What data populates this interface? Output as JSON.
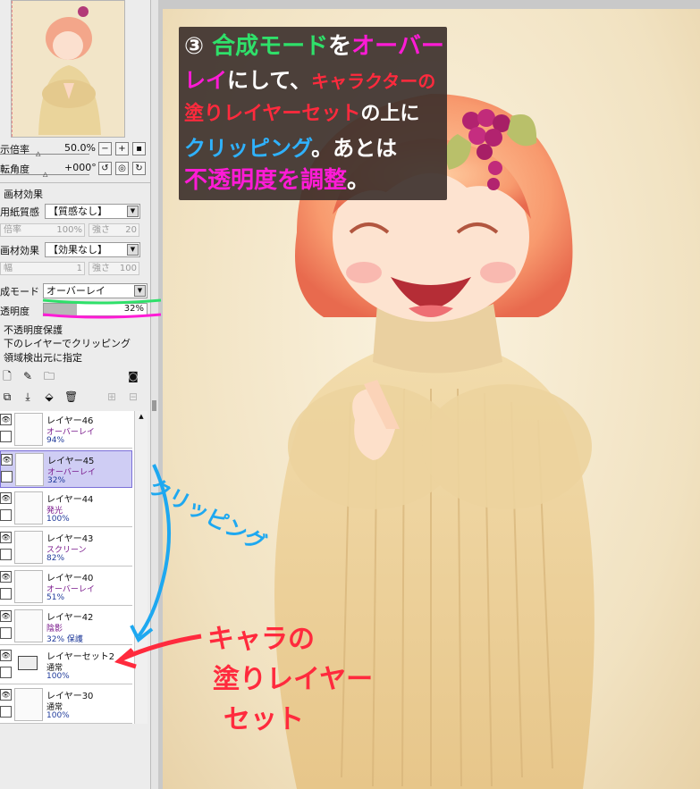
{
  "navigator": {
    "thumb_desc": ""
  },
  "view": {
    "zoom_label": "示倍率",
    "zoom_value": "50.0%",
    "rotate_label": "転角度",
    "rotate_value": "+000°"
  },
  "texture": {
    "header": "画材効果",
    "paper_label": "用紙質感",
    "paper_value": "【質感なし】",
    "paper_scale_label": "倍率",
    "paper_scale_value": "100%",
    "paper_strength_label": "強さ",
    "paper_strength_value": "20",
    "effect_label": "画材効果",
    "effect_value": "【効果なし】",
    "effect_width_label": "幅",
    "effect_width_value": "1",
    "effect_strength_label": "強さ",
    "effect_strength_value": "100"
  },
  "blend": {
    "mode_label": "成モード",
    "mode_value": "オーバーレイ",
    "opacity_label": "透明度",
    "opacity_value": "32%",
    "opacity_fraction": 0.32,
    "protect_opacity": "不透明度保護",
    "clip_below": "下のレイヤーでクリッピング",
    "selection_source": "領域検出元に指定"
  },
  "layers": [
    {
      "name": "レイヤー46",
      "mode": "オーバーレイ",
      "opacity": "94%",
      "selected": false,
      "mode_color": "#7a1a8c"
    },
    {
      "name": "レイヤー45",
      "mode": "オーバーレイ",
      "opacity": "32%",
      "selected": true,
      "mode_color": "#7a1a8c"
    },
    {
      "name": "レイヤー44",
      "mode": "発光",
      "opacity": "100%",
      "selected": false,
      "mode_color": "#7a1a8c"
    },
    {
      "name": "レイヤー43",
      "mode": "スクリーン",
      "opacity": "82%",
      "selected": false,
      "mode_color": "#7a1a8c"
    },
    {
      "name": "レイヤー40",
      "mode": "オーバーレイ",
      "opacity": "51%",
      "selected": false,
      "mode_color": "#7a1a8c"
    },
    {
      "name": "レイヤー42",
      "mode": "陰影",
      "opacity": "32% 保護",
      "selected": false,
      "mode_color": "#7a1a8c"
    },
    {
      "name": "レイヤーセット2",
      "mode": "通常",
      "opacity": "100%",
      "selected": false,
      "mode_color": "#111"
    },
    {
      "name": "レイヤー30",
      "mode": "通常",
      "opacity": "100%",
      "selected": false,
      "mode_color": "#111"
    }
  ],
  "instruction": {
    "num": "③",
    "line1a": "合成モード",
    "line1b": "を",
    "line1c": "オーバー",
    "line2a": "レイ",
    "line2b": "にして、",
    "line2c": "キャラクターの",
    "line3a": "塗りレイヤーセット",
    "line3b": "の上に",
    "line4a": "クリッピング",
    "line4b": "。あとは",
    "line5a": "不透明度を調整",
    "line5b": "。"
  },
  "annotations": {
    "clipping": "クリッピング",
    "chara_line1": "キャラの",
    "chara_line2": "塗りレイヤー",
    "chara_line3": "セット"
  },
  "colors": {
    "green": "#2fe06a",
    "magenta": "#ff1bd6",
    "red": "#ff2a3d",
    "cyan": "#2fb2ff",
    "blue_arrow": "#1ea8f0"
  }
}
